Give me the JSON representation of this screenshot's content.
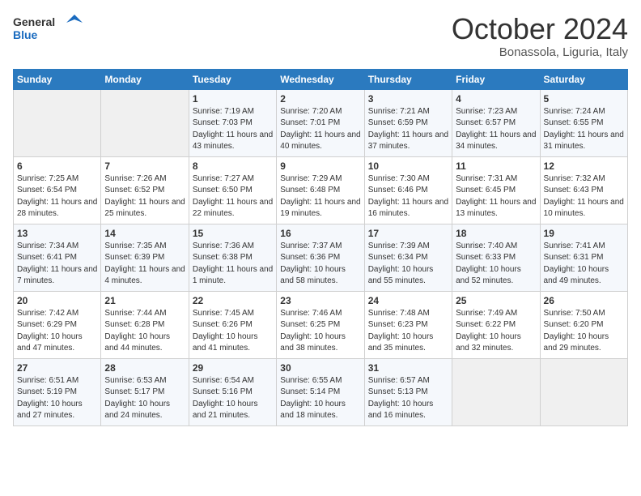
{
  "logo": {
    "line1": "General",
    "line2": "Blue"
  },
  "title": "October 2024",
  "subtitle": "Bonassola, Liguria, Italy",
  "headers": [
    "Sunday",
    "Monday",
    "Tuesday",
    "Wednesday",
    "Thursday",
    "Friday",
    "Saturday"
  ],
  "weeks": [
    [
      {
        "day": "",
        "info": ""
      },
      {
        "day": "",
        "info": ""
      },
      {
        "day": "1",
        "info": "Sunrise: 7:19 AM\nSunset: 7:03 PM\nDaylight: 11 hours and 43 minutes."
      },
      {
        "day": "2",
        "info": "Sunrise: 7:20 AM\nSunset: 7:01 PM\nDaylight: 11 hours and 40 minutes."
      },
      {
        "day": "3",
        "info": "Sunrise: 7:21 AM\nSunset: 6:59 PM\nDaylight: 11 hours and 37 minutes."
      },
      {
        "day": "4",
        "info": "Sunrise: 7:23 AM\nSunset: 6:57 PM\nDaylight: 11 hours and 34 minutes."
      },
      {
        "day": "5",
        "info": "Sunrise: 7:24 AM\nSunset: 6:55 PM\nDaylight: 11 hours and 31 minutes."
      }
    ],
    [
      {
        "day": "6",
        "info": "Sunrise: 7:25 AM\nSunset: 6:54 PM\nDaylight: 11 hours and 28 minutes."
      },
      {
        "day": "7",
        "info": "Sunrise: 7:26 AM\nSunset: 6:52 PM\nDaylight: 11 hours and 25 minutes."
      },
      {
        "day": "8",
        "info": "Sunrise: 7:27 AM\nSunset: 6:50 PM\nDaylight: 11 hours and 22 minutes."
      },
      {
        "day": "9",
        "info": "Sunrise: 7:29 AM\nSunset: 6:48 PM\nDaylight: 11 hours and 19 minutes."
      },
      {
        "day": "10",
        "info": "Sunrise: 7:30 AM\nSunset: 6:46 PM\nDaylight: 11 hours and 16 minutes."
      },
      {
        "day": "11",
        "info": "Sunrise: 7:31 AM\nSunset: 6:45 PM\nDaylight: 11 hours and 13 minutes."
      },
      {
        "day": "12",
        "info": "Sunrise: 7:32 AM\nSunset: 6:43 PM\nDaylight: 11 hours and 10 minutes."
      }
    ],
    [
      {
        "day": "13",
        "info": "Sunrise: 7:34 AM\nSunset: 6:41 PM\nDaylight: 11 hours and 7 minutes."
      },
      {
        "day": "14",
        "info": "Sunrise: 7:35 AM\nSunset: 6:39 PM\nDaylight: 11 hours and 4 minutes."
      },
      {
        "day": "15",
        "info": "Sunrise: 7:36 AM\nSunset: 6:38 PM\nDaylight: 11 hours and 1 minute."
      },
      {
        "day": "16",
        "info": "Sunrise: 7:37 AM\nSunset: 6:36 PM\nDaylight: 10 hours and 58 minutes."
      },
      {
        "day": "17",
        "info": "Sunrise: 7:39 AM\nSunset: 6:34 PM\nDaylight: 10 hours and 55 minutes."
      },
      {
        "day": "18",
        "info": "Sunrise: 7:40 AM\nSunset: 6:33 PM\nDaylight: 10 hours and 52 minutes."
      },
      {
        "day": "19",
        "info": "Sunrise: 7:41 AM\nSunset: 6:31 PM\nDaylight: 10 hours and 49 minutes."
      }
    ],
    [
      {
        "day": "20",
        "info": "Sunrise: 7:42 AM\nSunset: 6:29 PM\nDaylight: 10 hours and 47 minutes."
      },
      {
        "day": "21",
        "info": "Sunrise: 7:44 AM\nSunset: 6:28 PM\nDaylight: 10 hours and 44 minutes."
      },
      {
        "day": "22",
        "info": "Sunrise: 7:45 AM\nSunset: 6:26 PM\nDaylight: 10 hours and 41 minutes."
      },
      {
        "day": "23",
        "info": "Sunrise: 7:46 AM\nSunset: 6:25 PM\nDaylight: 10 hours and 38 minutes."
      },
      {
        "day": "24",
        "info": "Sunrise: 7:48 AM\nSunset: 6:23 PM\nDaylight: 10 hours and 35 minutes."
      },
      {
        "day": "25",
        "info": "Sunrise: 7:49 AM\nSunset: 6:22 PM\nDaylight: 10 hours and 32 minutes."
      },
      {
        "day": "26",
        "info": "Sunrise: 7:50 AM\nSunset: 6:20 PM\nDaylight: 10 hours and 29 minutes."
      }
    ],
    [
      {
        "day": "27",
        "info": "Sunrise: 6:51 AM\nSunset: 5:19 PM\nDaylight: 10 hours and 27 minutes."
      },
      {
        "day": "28",
        "info": "Sunrise: 6:53 AM\nSunset: 5:17 PM\nDaylight: 10 hours and 24 minutes."
      },
      {
        "day": "29",
        "info": "Sunrise: 6:54 AM\nSunset: 5:16 PM\nDaylight: 10 hours and 21 minutes."
      },
      {
        "day": "30",
        "info": "Sunrise: 6:55 AM\nSunset: 5:14 PM\nDaylight: 10 hours and 18 minutes."
      },
      {
        "day": "31",
        "info": "Sunrise: 6:57 AM\nSunset: 5:13 PM\nDaylight: 10 hours and 16 minutes."
      },
      {
        "day": "",
        "info": ""
      },
      {
        "day": "",
        "info": ""
      }
    ]
  ]
}
